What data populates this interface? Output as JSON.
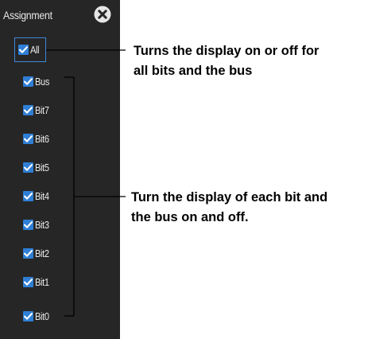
{
  "panel": {
    "title": "Assignment",
    "close_icon": "close-circle-icon",
    "background": "#262626",
    "accent": "#2f7fd6"
  },
  "items": [
    {
      "id": "all",
      "label": "All",
      "checked": true
    },
    {
      "id": "bus",
      "label": "Bus",
      "checked": true
    },
    {
      "id": "bit7",
      "label": "Bit7",
      "checked": true
    },
    {
      "id": "bit6",
      "label": "Bit6",
      "checked": true
    },
    {
      "id": "bit5",
      "label": "Bit5",
      "checked": true
    },
    {
      "id": "bit4",
      "label": "Bit4",
      "checked": true
    },
    {
      "id": "bit3",
      "label": "Bit3",
      "checked": true
    },
    {
      "id": "bit2",
      "label": "Bit2",
      "checked": true
    },
    {
      "id": "bit1",
      "label": "Bit1",
      "checked": true
    },
    {
      "id": "bit0",
      "label": "Bit0",
      "checked": true
    }
  ],
  "callouts": {
    "all_line1": "Turns the display on or off for",
    "all_line2": "all bits and the bus",
    "bits_line1": "Turn the display of each bit and",
    "bits_line2": "the bus on and off."
  }
}
